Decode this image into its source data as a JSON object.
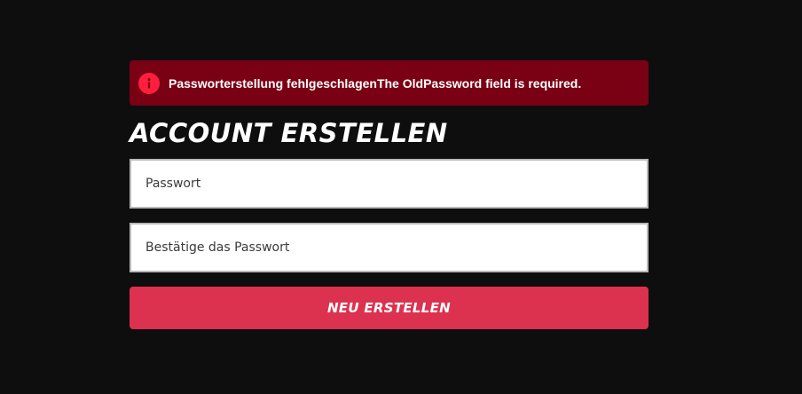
{
  "alert": {
    "message": "Passworterstellung fehlgeschlagenThe OldPassword field is required.",
    "icon": "info-icon",
    "background_color": "#7a0014",
    "icon_color": "#ff1f3d"
  },
  "form": {
    "title": "ACCOUNT ERSTELLEN",
    "password_placeholder": "Passwort",
    "confirm_password_placeholder": "Bestätige das Passwort",
    "submit_label": "NEU ERSTELLEN",
    "submit_color": "#dc314f"
  }
}
